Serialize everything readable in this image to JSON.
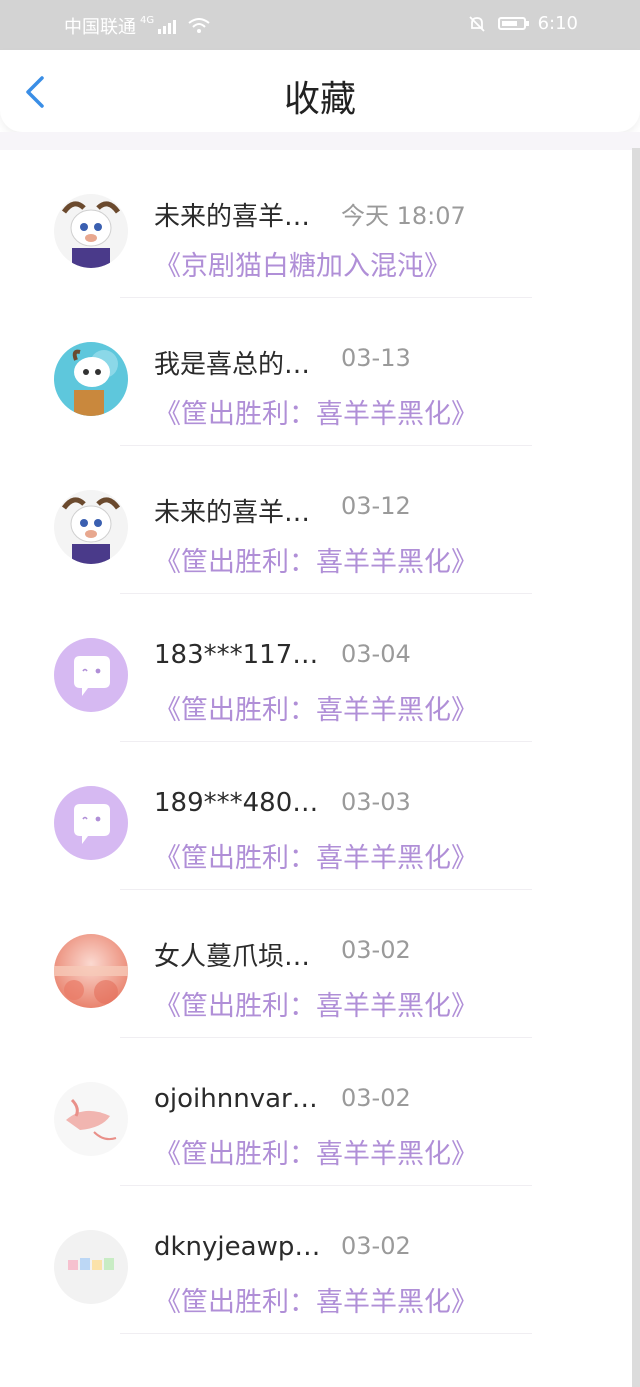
{
  "status": {
    "carrier": "中国联通",
    "network": "4G",
    "time": "6:10"
  },
  "header": {
    "title": "收藏"
  },
  "items": [
    {
      "name": "未来的喜羊…",
      "time": "今天 18:07",
      "work": "《京剧猫白糖加入混沌》",
      "avatar": "goat-avatar"
    },
    {
      "name": "我是喜总的…",
      "time": "03-13",
      "work": "《筐出胜利：喜羊羊黑化》",
      "avatar": "goat-blue-avatar"
    },
    {
      "name": "未来的喜羊…",
      "time": "03-12",
      "work": "《筐出胜利：喜羊羊黑化》",
      "avatar": "goat-avatar"
    },
    {
      "name": "183***117…",
      "time": "03-04",
      "work": "《筐出胜利：喜羊羊黑化》",
      "avatar": "chat-bubble-avatar"
    },
    {
      "name": "189***480…",
      "time": "03-03",
      "work": "《筐出胜利：喜羊羊黑化》",
      "avatar": "chat-bubble-avatar"
    },
    {
      "name": "女人蔓爪埙…",
      "time": "03-02",
      "work": "《筐出胜利：喜羊羊黑化》",
      "avatar": "flower-avatar"
    },
    {
      "name": "ojoihnnvar…",
      "time": "03-02",
      "work": "《筐出胜利：喜羊羊黑化》",
      "avatar": "red-sketch-avatar"
    },
    {
      "name": "dknyjeawp…",
      "time": "03-02",
      "work": "《筐出胜利：喜羊羊黑化》",
      "avatar": "colorful-text-avatar"
    }
  ],
  "colors": {
    "accent": "#b08fd7",
    "back_icon": "#3a8ee6",
    "status_bar": "#d3d3d3"
  }
}
